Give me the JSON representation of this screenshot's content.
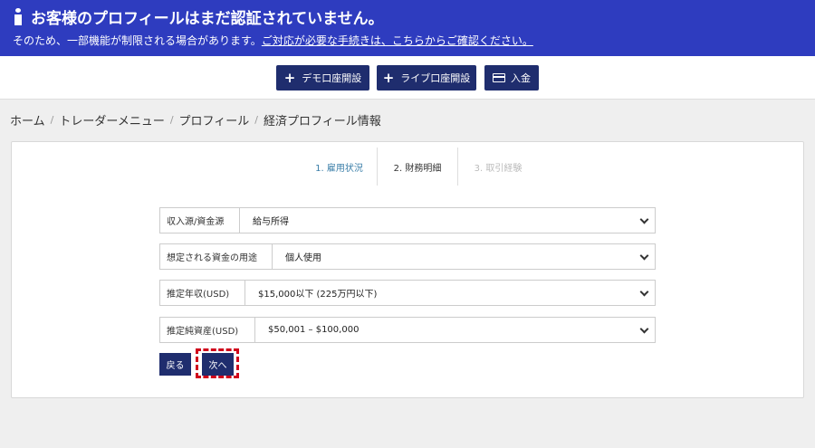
{
  "banner": {
    "title": "お客様のプロフィールはまだ認証されていません。",
    "message": "そのため、一部機能が制限される場合があります。",
    "link_text": "ご対応が必要な手続きは、こちらからご確認ください。"
  },
  "actions": {
    "demo_account": "デモ口座開設",
    "live_account": "ライブ口座開設",
    "deposit": "入金"
  },
  "breadcrumb": [
    "ホーム",
    "トレーダーメニュー",
    "プロフィール",
    "経済プロフィール情報"
  ],
  "steps": [
    {
      "label": "1. 雇用状況",
      "state": "completed"
    },
    {
      "label": "2. 財務明細",
      "state": "current"
    },
    {
      "label": "3. 取引経験",
      "state": "upcoming"
    }
  ],
  "form": {
    "income_source": {
      "label": "収入源/資金源",
      "value": "給与所得"
    },
    "fund_purpose": {
      "label": "想定される資金の用途",
      "value": "個人使用"
    },
    "annual_income": {
      "label": "推定年収(USD)",
      "value": "$15,000以下 (225万円以下)"
    },
    "net_worth": {
      "label": "推定純資産(USD)",
      "value": "$50,001 – $100,000"
    }
  },
  "buttons": {
    "back": "戻る",
    "next": "次へ"
  },
  "colors": {
    "banner_bg": "#2e3cbf",
    "button_navy": "#1f2d6e",
    "step_done": "#3a7ea8",
    "highlight_red": "#d0021b"
  }
}
